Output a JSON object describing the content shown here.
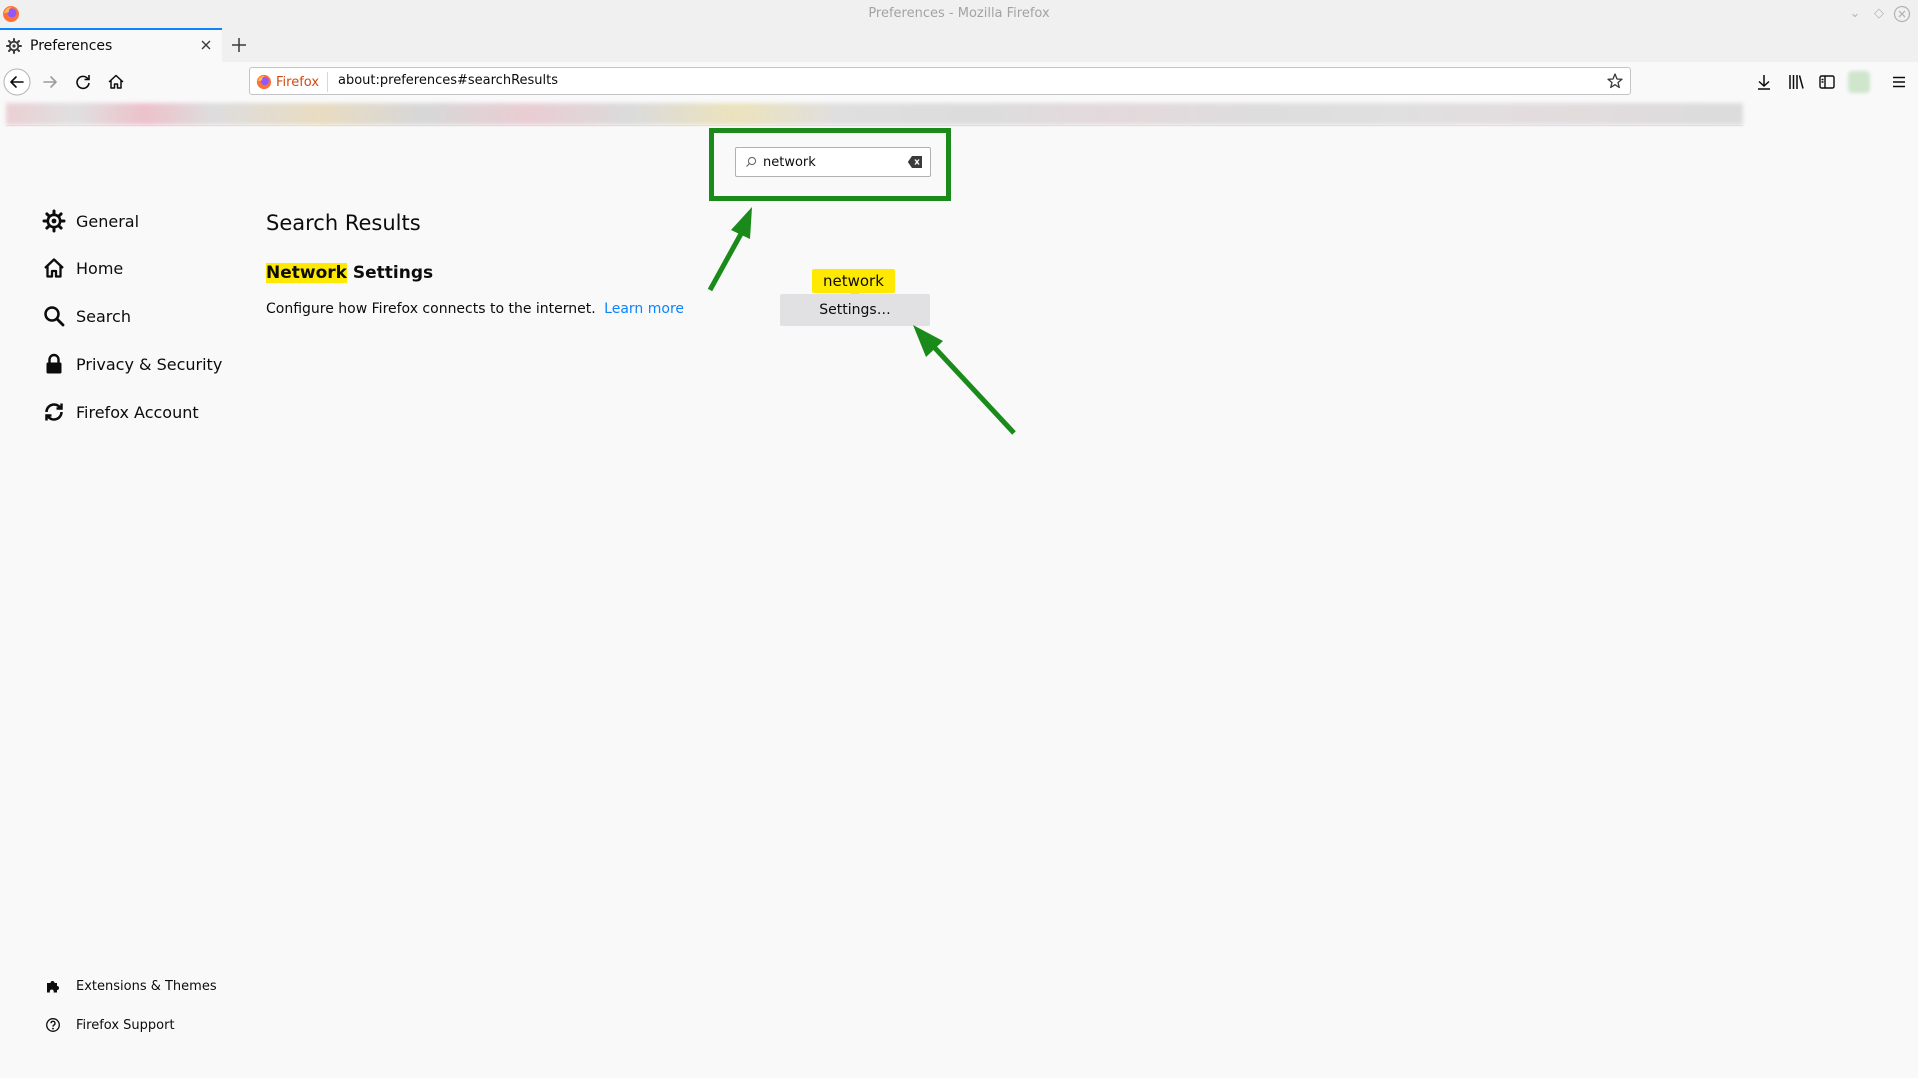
{
  "window": {
    "title": "Preferences - Mozilla Firefox"
  },
  "tab": {
    "title": "Preferences"
  },
  "urlbar": {
    "identity_label": "Firefox",
    "url": "about:preferences#searchResults"
  },
  "search": {
    "value": "network",
    "placeholder": ""
  },
  "sidebar": {
    "items": [
      {
        "label": "General",
        "icon": "gear-icon"
      },
      {
        "label": "Home",
        "icon": "home-icon"
      },
      {
        "label": "Search",
        "icon": "magnifier-icon"
      },
      {
        "label": "Privacy & Security",
        "icon": "lock-icon"
      },
      {
        "label": "Firefox Account",
        "icon": "sync-icon"
      }
    ],
    "footer": [
      {
        "label": "Extensions & Themes",
        "icon": "puzzle-icon"
      },
      {
        "label": "Firefox Support",
        "icon": "help-icon"
      }
    ]
  },
  "results": {
    "title": "Search Results",
    "section_highlight": "Network",
    "section_rest": " Settings",
    "description": "Configure how Firefox connects to the internet.",
    "learn_more": "Learn more",
    "tooltip": "network",
    "settings_button": "Settings…"
  },
  "colors": {
    "accent": "#0a84ff",
    "highlight": "#ffe900",
    "annotation_green": "#1a8a1a"
  }
}
